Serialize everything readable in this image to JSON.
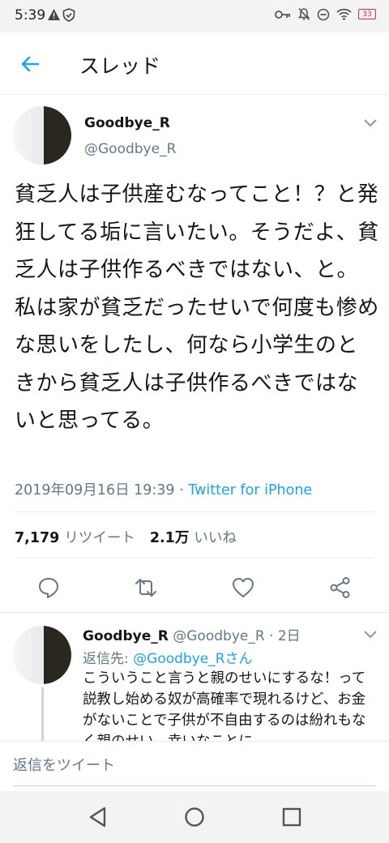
{
  "status_bar": {
    "time": "5:39",
    "battery": "33"
  },
  "app_bar": {
    "title": "スレッド"
  },
  "tweet": {
    "display_name": "Goodbye_R",
    "handle": "@Goodbye_R",
    "text": "貧乏人は子供産むなってこと！？と発狂してる垢に言いたい。そうだよ、貧乏人は子供作るべきではない、と。私は家が貧乏だったせいで何度も惨めな思いをしたし、何なら小学生のときから貧乏人は子供作るべきではないと思ってる。",
    "timestamp": "2019年09月16日 19:39",
    "separator": " · ",
    "source": "Twitter for iPhone",
    "retweet_count": "7,179",
    "retweet_label": "リツイート",
    "like_count": "2.1万",
    "like_label": "いいね"
  },
  "reply": {
    "display_name": "Goodbye_R",
    "handle_time": " @Goodbye_R · 2日",
    "reply_to_prefix": "返信先: ",
    "reply_to_mention": "@Goodbye_Rさん",
    "text": "こういうこと言うと親のせいにするな！って説教し始める奴が高確率で現れるけど、お金がないことで子供が不自由するのは紛れもなく親のせい。幸いなことに"
  },
  "composer": {
    "placeholder": "返信をツイート"
  },
  "colors": {
    "accent": "#1da1f2",
    "secondary_text": "#657786",
    "divider": "#e6ecf0"
  }
}
